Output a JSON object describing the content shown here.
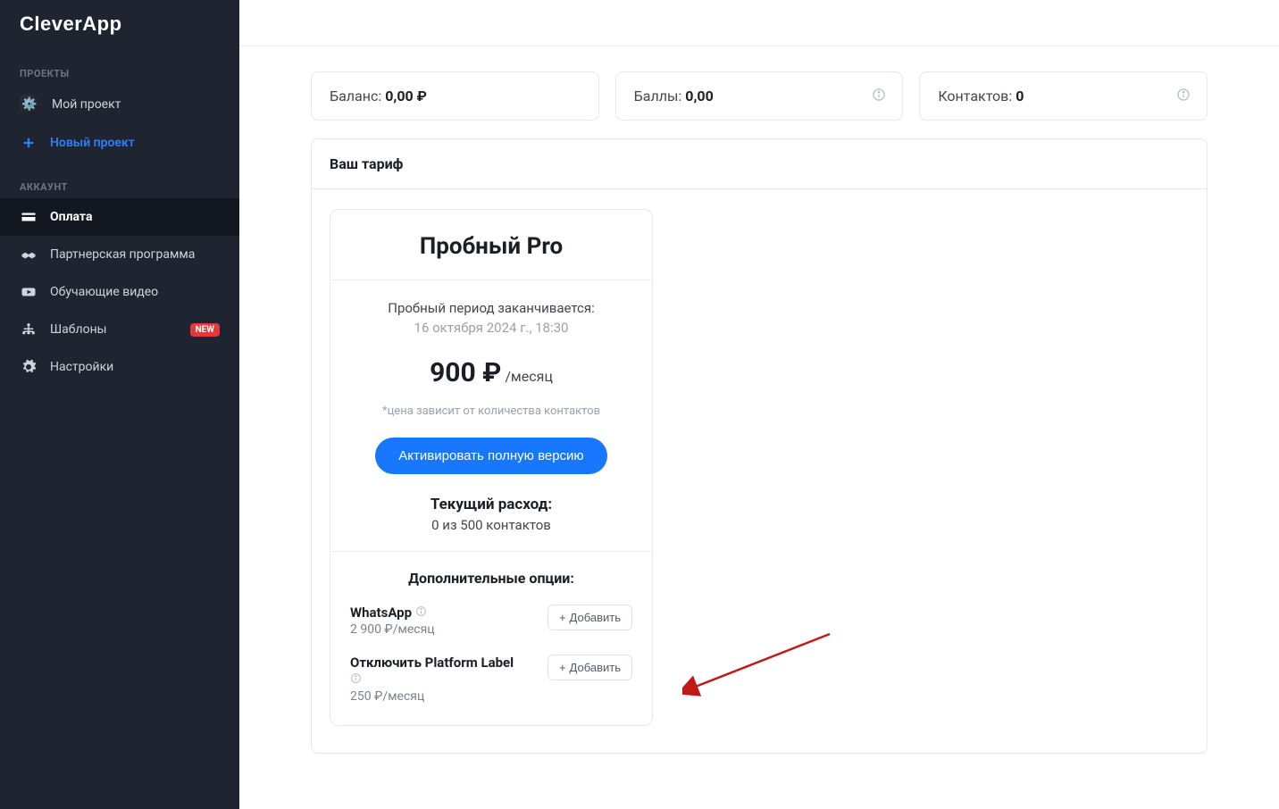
{
  "app_name": "CleverApp",
  "sidebar": {
    "section_projects": "ПРОЕКТЫ",
    "section_account": "АККАУНТ",
    "my_project": "Мой проект",
    "new_project": "Новый проект",
    "payment": "Оплата",
    "partner": "Партнерская программа",
    "videos": "Обучающие видео",
    "templates": "Шаблоны",
    "settings": "Настройки",
    "badge_new": "NEW"
  },
  "stats": {
    "balance_label": "Баланс:",
    "balance_value": "0,00 ₽",
    "points_label": "Баллы:",
    "points_value": "0,00",
    "contacts_label": "Контактов:",
    "contacts_value": "0"
  },
  "tariff": {
    "panel_title": "Ваш тариф",
    "plan_name": "Пробный Pro",
    "trial_text": "Пробный период заканчивается:",
    "trial_date": "16 октября 2024 г., 18:30",
    "price": "900 ₽",
    "per": "/месяц",
    "price_note": "*цена зависит от количества контактов",
    "activate": "Активировать полную версию",
    "usage_label": "Текущий расход:",
    "usage_value": "0 из 500 контактов",
    "options_title": "Дополнительные опции:",
    "options": [
      {
        "name": "WhatsApp",
        "price": "2 900 ₽/месяц",
        "btn": "Добавить",
        "info_inline": true
      },
      {
        "name": "Отключить Platform Label",
        "price": "250 ₽/месяц",
        "btn": "Добавить",
        "info_inline": false
      }
    ]
  }
}
